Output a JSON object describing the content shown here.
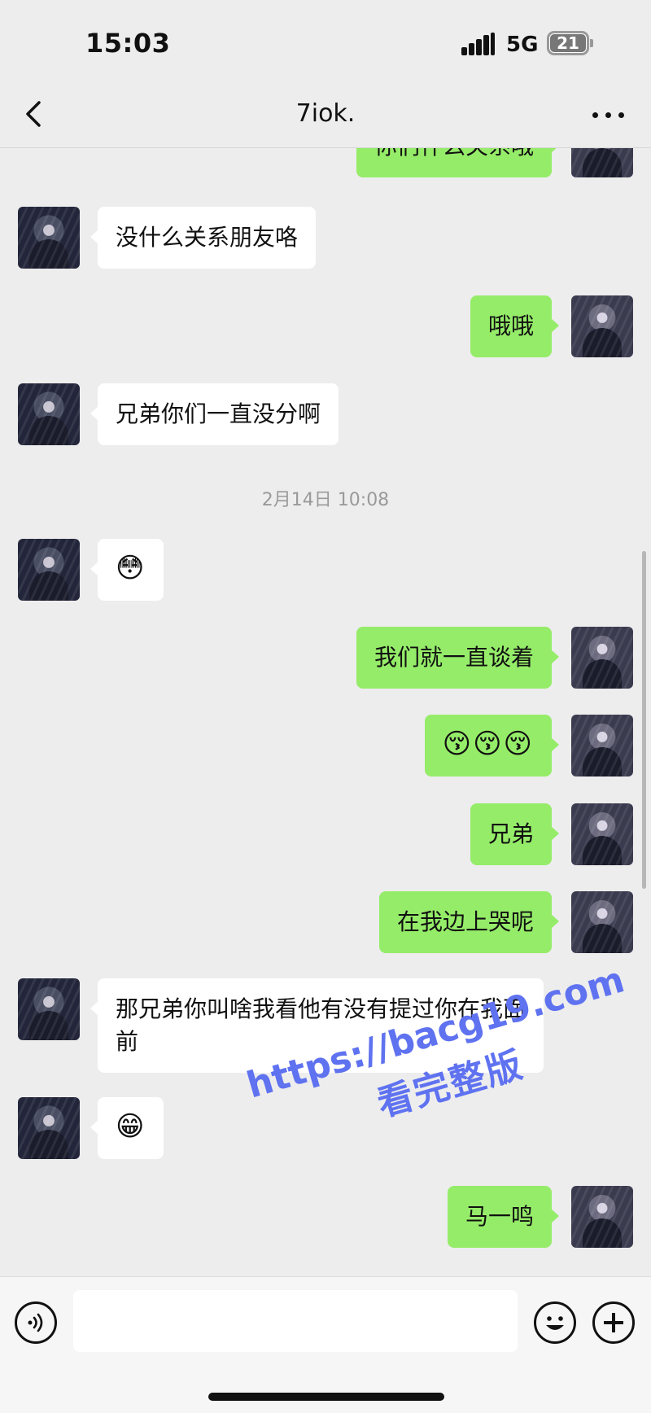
{
  "status_bar": {
    "time": "15:03",
    "network": "5G",
    "battery": "21",
    "icons": [
      "signal-icon",
      "battery-icon"
    ]
  },
  "header": {
    "title": "7iok.",
    "icons": [
      "back-icon",
      "more-icon"
    ]
  },
  "messages": [
    {
      "side": "out",
      "text": "你们什么关系哦"
    },
    {
      "side": "in",
      "text": "没什么关系朋友咯"
    },
    {
      "side": "out",
      "text": "哦哦"
    },
    {
      "side": "in",
      "text": "兄弟你们一直没分啊"
    },
    {
      "type": "timestamp",
      "text": "2月14日 10:08"
    },
    {
      "side": "in",
      "text": "😳"
    },
    {
      "side": "out",
      "text": "我们就一直谈着"
    },
    {
      "side": "out",
      "text": "😚😚😚"
    },
    {
      "side": "out",
      "text": "兄弟"
    },
    {
      "side": "out",
      "text": "在我边上哭呢"
    },
    {
      "side": "in",
      "text": "那兄弟你叫啥我看他有没有提过你在我面前"
    },
    {
      "side": "in",
      "text": "😁"
    },
    {
      "side": "out",
      "text": "马一鸣"
    }
  ],
  "watermark": {
    "url": "https://bacg19.com",
    "subtitle": "看完整版"
  },
  "input_bar": {
    "value": "",
    "icons": [
      "voice-icon",
      "emoji-icon",
      "plus-icon"
    ]
  },
  "colors": {
    "background": "#ededed",
    "outgoing_bubble": "#95ec69",
    "incoming_bubble": "#ffffff",
    "watermark": "#5f72f0"
  }
}
